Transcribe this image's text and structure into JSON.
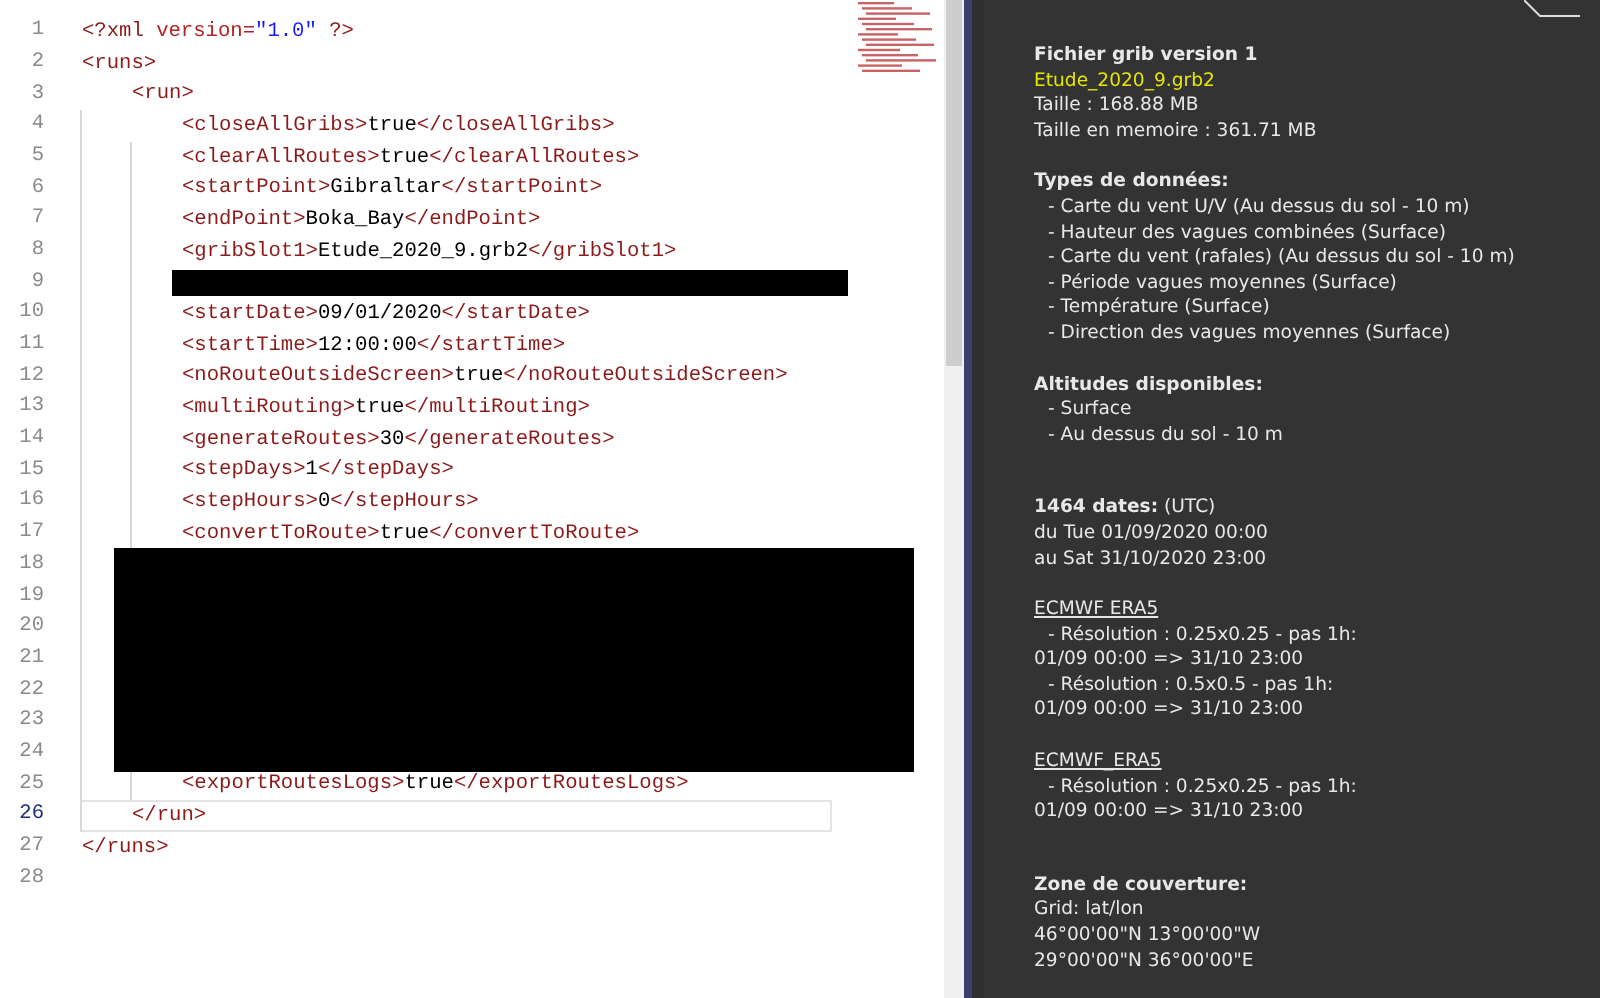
{
  "editor": {
    "lines": [
      {
        "number": "1",
        "kind": "code",
        "selected": false,
        "segments": [
          {
            "kind": "decl",
            "text": "<?xml "
          },
          {
            "kind": "attr",
            "text": "version="
          },
          {
            "kind": "value",
            "text": "\"1.0\""
          },
          {
            "kind": "decl",
            "text": " ?>"
          }
        ]
      },
      {
        "number": "2",
        "kind": "code",
        "selected": false,
        "segments": [
          {
            "kind": "open",
            "text": "<runs>"
          }
        ]
      },
      {
        "number": "3",
        "kind": "code",
        "selected": false,
        "segments": [
          {
            "kind": "open",
            "text": "<run>"
          }
        ]
      },
      {
        "number": "4",
        "kind": "code",
        "selected": false,
        "segments": [
          {
            "kind": "open",
            "text": "<closeAllGribs>"
          },
          {
            "kind": "text",
            "text": "true"
          },
          {
            "kind": "close",
            "text": "</closeAllGribs>"
          }
        ]
      },
      {
        "number": "5",
        "kind": "code",
        "selected": false,
        "segments": [
          {
            "kind": "open",
            "text": "<clearAllRoutes>"
          },
          {
            "kind": "text",
            "text": "true"
          },
          {
            "kind": "close",
            "text": "</clearAllRoutes>"
          }
        ]
      },
      {
        "number": "6",
        "kind": "code",
        "selected": false,
        "segments": [
          {
            "kind": "open",
            "text": "<startPoint>"
          },
          {
            "kind": "text",
            "text": "Gibraltar"
          },
          {
            "kind": "close",
            "text": "</startPoint>"
          }
        ]
      },
      {
        "number": "7",
        "kind": "code",
        "selected": false,
        "segments": [
          {
            "kind": "open",
            "text": "<endPoint>"
          },
          {
            "kind": "text",
            "text": "Boka_Bay"
          },
          {
            "kind": "close",
            "text": "</endPoint>"
          }
        ]
      },
      {
        "number": "8",
        "kind": "code",
        "selected": false,
        "segments": [
          {
            "kind": "open",
            "text": "<gribSlot1>"
          },
          {
            "kind": "text",
            "text": "Etude_2020_9.grb2"
          },
          {
            "kind": "close",
            "text": "</gribSlot1>"
          }
        ]
      },
      {
        "number": "9",
        "kind": "redacted",
        "selected": false
      },
      {
        "number": "10",
        "kind": "code",
        "selected": false,
        "segments": [
          {
            "kind": "open",
            "text": "<startDate>"
          },
          {
            "kind": "text",
            "text": "09/01/2020"
          },
          {
            "kind": "close",
            "text": "</startDate>"
          }
        ]
      },
      {
        "number": "11",
        "kind": "code",
        "selected": false,
        "segments": [
          {
            "kind": "open",
            "text": "<startTime>"
          },
          {
            "kind": "text",
            "text": "12:00:00"
          },
          {
            "kind": "close",
            "text": "</startTime>"
          }
        ]
      },
      {
        "number": "12",
        "kind": "code",
        "selected": false,
        "segments": [
          {
            "kind": "open",
            "text": "<noRouteOutsideScreen>"
          },
          {
            "kind": "text",
            "text": "true"
          },
          {
            "kind": "close",
            "text": "</noRouteOutsideScreen>"
          }
        ]
      },
      {
        "number": "13",
        "kind": "code",
        "selected": false,
        "segments": [
          {
            "kind": "open",
            "text": "<multiRouting>"
          },
          {
            "kind": "text",
            "text": "true"
          },
          {
            "kind": "close",
            "text": "</multiRouting>"
          }
        ]
      },
      {
        "number": "14",
        "kind": "code",
        "selected": false,
        "segments": [
          {
            "kind": "open",
            "text": "<generateRoutes>"
          },
          {
            "kind": "text",
            "text": "30"
          },
          {
            "kind": "close",
            "text": "</generateRoutes>"
          }
        ]
      },
      {
        "number": "15",
        "kind": "code",
        "selected": false,
        "segments": [
          {
            "kind": "open",
            "text": "<stepDays>"
          },
          {
            "kind": "text",
            "text": "1"
          },
          {
            "kind": "close",
            "text": "</stepDays>"
          }
        ]
      },
      {
        "number": "16",
        "kind": "code",
        "selected": false,
        "segments": [
          {
            "kind": "open",
            "text": "<stepHours>"
          },
          {
            "kind": "text",
            "text": "0"
          },
          {
            "kind": "close",
            "text": "</stepHours>"
          }
        ]
      },
      {
        "number": "17",
        "kind": "code",
        "selected": false,
        "segments": [
          {
            "kind": "open",
            "text": "<convertToRoute>"
          },
          {
            "kind": "text",
            "text": "true"
          },
          {
            "kind": "close",
            "text": "</convertToRoute>"
          }
        ]
      },
      {
        "number": "18",
        "kind": "redacted",
        "selected": false
      },
      {
        "number": "19",
        "kind": "redacted",
        "selected": false
      },
      {
        "number": "20",
        "kind": "redacted",
        "selected": false
      },
      {
        "number": "21",
        "kind": "redacted",
        "selected": false
      },
      {
        "number": "22",
        "kind": "redacted",
        "selected": false
      },
      {
        "number": "23",
        "kind": "redacted",
        "selected": false
      },
      {
        "number": "24",
        "kind": "redacted",
        "selected": false
      },
      {
        "number": "25",
        "kind": "code",
        "selected": false,
        "segments": [
          {
            "kind": "open",
            "text": "<exportRoutesLogs>"
          },
          {
            "kind": "text",
            "text": "true"
          },
          {
            "kind": "close",
            "text": "</exportRoutesLogs>"
          }
        ]
      },
      {
        "number": "26",
        "kind": "code",
        "selected": true,
        "segments": [
          {
            "kind": "close",
            "text": "</run>"
          }
        ]
      },
      {
        "number": "27",
        "kind": "code",
        "selected": false,
        "segments": [
          {
            "kind": "close",
            "text": "</runs>"
          }
        ]
      },
      {
        "number": "28",
        "kind": "code",
        "selected": false
      }
    ]
  },
  "info_panel": {
    "sections": [
      {
        "heading": "Fichier grib version 1",
        "items": [
          {
            "kind": "filename",
            "text": "Etude_2020_9.grb2"
          },
          {
            "kind": "text",
            "text": "Taille : 168.88 MB"
          },
          {
            "kind": "text",
            "text": "Taille en memoire : 361.71 MB"
          }
        ]
      },
      {
        "heading": "Types de données:",
        "items": [
          {
            "kind": "bullet",
            "text": "- Carte du vent U/V (Au dessus du sol - 10 m)"
          },
          {
            "kind": "bullet",
            "text": "- Hauteur des vagues combinées (Surface)"
          },
          {
            "kind": "bullet",
            "text": "- Carte du vent (rafales) (Au dessus du sol - 10 m)"
          },
          {
            "kind": "bullet",
            "text": "- Période vagues moyennes (Surface)"
          },
          {
            "kind": "bullet",
            "text": "- Température (Surface)"
          },
          {
            "kind": "bullet",
            "text": "- Direction des vagues moyennes (Surface)"
          }
        ]
      },
      {
        "heading": "Altitudes disponibles:",
        "items": [
          {
            "kind": "bullet",
            "text": "- Surface"
          },
          {
            "kind": "bullet",
            "text": "- Au dessus du sol - 10 m"
          }
        ]
      },
      {
        "items": [
          {
            "kind": "text",
            "text": "**1464 dates:** (UTC)"
          },
          {
            "kind": "text",
            "text": "du Tue 01/09/2020 00:00"
          },
          {
            "kind": "text",
            "text": "au Sat 31/10/2020 23:00"
          }
        ]
      },
      {
        "source": "ECMWF ERA5",
        "items": [
          {
            "kind": "bullet",
            "text": "- Résolution : 0.25x0.25 - pas 1h:"
          },
          {
            "kind": "text",
            "text": "01/09 00:00 => 31/10 23:00"
          },
          {
            "kind": "bullet",
            "text": "- Résolution : 0.5x0.5 - pas 1h:"
          },
          {
            "kind": "text",
            "text": "01/09 00:00 => 31/10 23:00"
          }
        ]
      },
      {
        "source": "ECMWF_ERA5",
        "items": [
          {
            "kind": "bullet",
            "text": "- Résolution : 0.25x0.25 - pas 1h:"
          },
          {
            "kind": "text",
            "text": "01/09 00:00 => 31/10 23:00"
          }
        ]
      },
      {
        "heading": "Zone de couverture:",
        "items": [
          {
            "kind": "text",
            "text": "Grid: lat/lon"
          },
          {
            "kind": "text",
            "text": "46°00'00\"N 13°00'00\"W"
          },
          {
            "kind": "text",
            "text": "29°00'00\"N 36°00'00\"E"
          }
        ]
      }
    ]
  }
}
